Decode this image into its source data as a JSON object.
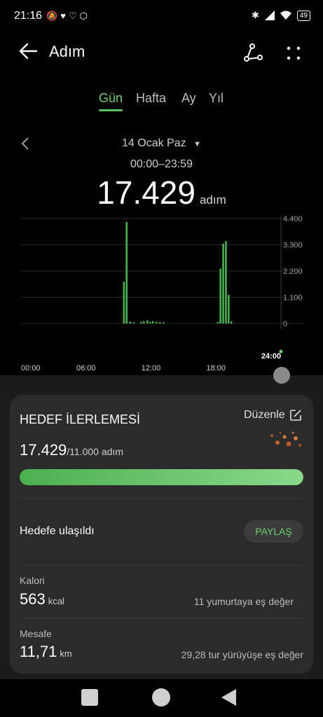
{
  "status": {
    "time": "21:16",
    "battery": "49"
  },
  "header": {
    "title": "Adım"
  },
  "tabs": [
    {
      "label": "Gün"
    },
    {
      "label": "Hafta"
    },
    {
      "label": "Ay"
    },
    {
      "label": "Yıl"
    }
  ],
  "date": {
    "label": "14 Ocak Paz",
    "range": "00:00–23:59"
  },
  "summary": {
    "steps": "17.429",
    "unit": "adım"
  },
  "chart_data": {
    "type": "bar",
    "xlabels": [
      "00:00",
      "06:00",
      "12:00",
      "18:00",
      "24:00"
    ],
    "yticks": [
      "4.400",
      "3.300",
      "2.200",
      "1.100",
      "0"
    ],
    "ylim": [
      0,
      4400
    ],
    "values": [
      0,
      0,
      0,
      0,
      0,
      0,
      0,
      0,
      0,
      0,
      0,
      0,
      0,
      0,
      0,
      0,
      0,
      0,
      0,
      0,
      0,
      0,
      0,
      0,
      0,
      0,
      0,
      0,
      0,
      0,
      0,
      0,
      0,
      0,
      0,
      0,
      0,
      0,
      0,
      0,
      0,
      0,
      0,
      0,
      0,
      0,
      0,
      0,
      0,
      0,
      0,
      0,
      0,
      0,
      0,
      0,
      0,
      0,
      0,
      0,
      0,
      0,
      0,
      0,
      0,
      0,
      0,
      0,
      0,
      0,
      0,
      0,
      0,
      0,
      0,
      0,
      0,
      0,
      0,
      0,
      0,
      0,
      0,
      0,
      0,
      0,
      0,
      0,
      0,
      0,
      0,
      0,
      0,
      0,
      0,
      0,
      0,
      0,
      0,
      0,
      0,
      0,
      0,
      0,
      0,
      0,
      0,
      0,
      0,
      0,
      0,
      0,
      0,
      0,
      0,
      0,
      0,
      0,
      0,
      0,
      0,
      0,
      0,
      0,
      0,
      0,
      0,
      0,
      0,
      0,
      0,
      0,
      0,
      0,
      0,
      0,
      0,
      0,
      0,
      0,
      0,
      0,
      0,
      0,
      0,
      0,
      0,
      0,
      0,
      0,
      0,
      0,
      0,
      0,
      0,
      0,
      0,
      0,
      0,
      0,
      0,
      0,
      0,
      0,
      0,
      0,
      0,
      0,
      0,
      0,
      0,
      0,
      0,
      0,
      0,
      0,
      0,
      0,
      0,
      0,
      0,
      0,
      0,
      0,
      0,
      0,
      0,
      0,
      0,
      0,
      0,
      0,
      0,
      0,
      0,
      0,
      0,
      0,
      0,
      0,
      0,
      0,
      0,
      0,
      0,
      0,
      0,
      0,
      0,
      0,
      0,
      0,
      0,
      0,
      0,
      0,
      0,
      0,
      0,
      0,
      0,
      0,
      0,
      0,
      0,
      0,
      0,
      0,
      0,
      0,
      0,
      0,
      0,
      0,
      0,
      0,
      0,
      0,
      0,
      0,
      0,
      0,
      0,
      0,
      0,
      0,
      0,
      0,
      0,
      0,
      0,
      0,
      0,
      0,
      0,
      0,
      0,
      0,
      0,
      0,
      0,
      0,
      0,
      0,
      0,
      0,
      0,
      0,
      0,
      0,
      0,
      0,
      0,
      0,
      0,
      0,
      0,
      0,
      0,
      0,
      0,
      0,
      0,
      0,
      0,
      0,
      0,
      0,
      0,
      0,
      0,
      0,
      0,
      0,
      0,
      0,
      0,
      0,
      0,
      0
    ],
    "bars": [
      {
        "time": "09:30",
        "value": 1750
      },
      {
        "time": "09:45",
        "value": 4250
      },
      {
        "time": "10:05",
        "value": 80
      },
      {
        "time": "10:25",
        "value": 50
      },
      {
        "time": "11:05",
        "value": 60
      },
      {
        "time": "11:20",
        "value": 90
      },
      {
        "time": "11:40",
        "value": 130
      },
      {
        "time": "11:55",
        "value": 60
      },
      {
        "time": "12:10",
        "value": 100
      },
      {
        "time": "12:30",
        "value": 70
      },
      {
        "time": "12:50",
        "value": 60
      },
      {
        "time": "13:10",
        "value": 50
      },
      {
        "time": "18:10",
        "value": 60
      },
      {
        "time": "18:25",
        "value": 2300
      },
      {
        "time": "18:40",
        "value": 3350
      },
      {
        "time": "18:55",
        "value": 3450
      },
      {
        "time": "19:10",
        "value": 1200
      },
      {
        "time": "19:25",
        "value": 90
      }
    ]
  },
  "goal": {
    "title": "HEDEF İLERLEMESİ",
    "edit_label": "Düzenle",
    "current": "17.429",
    "target_text": "/11.000 adım",
    "progress_fraction": 1.0,
    "reached_label": "Hedefe ulaşıldı",
    "share_label": "PAYLAŞ"
  },
  "stats": {
    "calories": {
      "label": "Kalori",
      "value": "563",
      "unit": "kcal",
      "equivalent": "11 yumurtaya eş değer"
    },
    "distance": {
      "label": "Mesafe",
      "value": "11,71",
      "unit": "km",
      "equivalent": "29,28 tur yürüyüşe eş değer"
    }
  },
  "colors": {
    "accent": "#6fcf6f",
    "bar": "#4caf50",
    "background": "#000000",
    "card": "#2b2b2b"
  }
}
